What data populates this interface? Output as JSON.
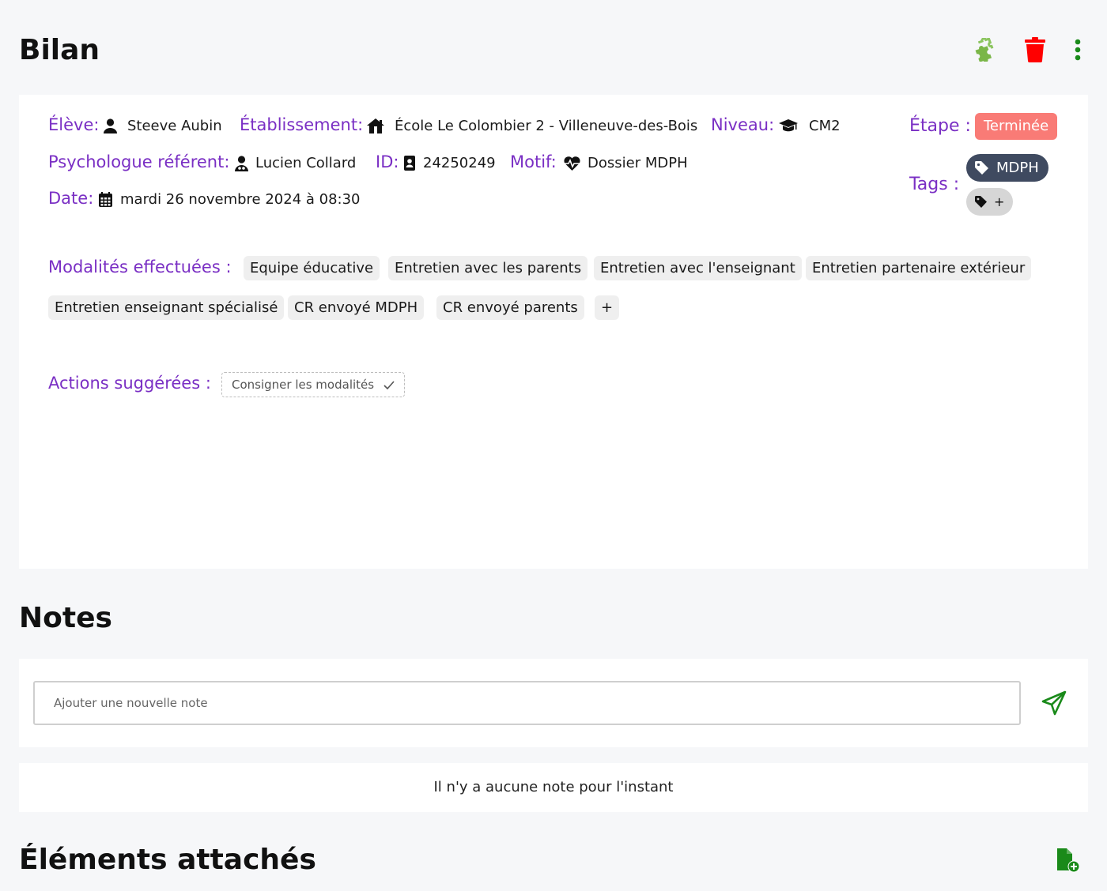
{
  "header": {
    "title": "Bilan",
    "icons": [
      "puzzle-icon",
      "trash-icon",
      "kebab-menu-icon"
    ],
    "colors": {
      "puzzle": "#7ab648",
      "trash": "#ff0000",
      "kebab": "#1a8a1a"
    }
  },
  "info": {
    "student_label": "Élève:",
    "student_value": "Steeve Aubin",
    "school_label": "Établissement:",
    "school_value": "École Le Colombier 2 - Villeneuve-des-Bois",
    "level_label": "Niveau:",
    "level_value": "CM2",
    "psych_label": "Psychologue référent:",
    "psych_value": "Lucien Collard",
    "id_label": "ID:",
    "id_value": "24250249",
    "reason_label": "Motif:",
    "reason_value": "Dossier MDPH",
    "date_label": "Date:",
    "date_value": "mardi 26 novembre 2024 à 08:30",
    "step_label": "Étape :",
    "step_value": "Terminée",
    "tags_label": "Tags :",
    "tags": [
      "MDPH"
    ],
    "tag_add_label": "+"
  },
  "modalities": {
    "label": "Modalités effectuées :",
    "items": [
      "Equipe éducative",
      "Entretien avec les parents",
      "Entretien avec l'enseignant",
      "Entretien partenaire extérieur",
      "Entretien enseignant spécialisé",
      "CR envoyé MDPH",
      "CR envoyé parents"
    ],
    "add_label": "+"
  },
  "actions": {
    "label": "Actions suggérées :",
    "suggestion": "Consigner les modalités"
  },
  "notes": {
    "title": "Notes",
    "placeholder": "Ajouter une nouvelle note",
    "empty_text": "Il n'y a aucune note pour l'instant"
  },
  "attachments": {
    "title": "Éléments attachés"
  },
  "colors": {
    "accent_purple": "#7a2fc4",
    "step_badge": "#f97b76",
    "tag_badge": "#3f4a60",
    "send_green": "#1a8a1a"
  }
}
